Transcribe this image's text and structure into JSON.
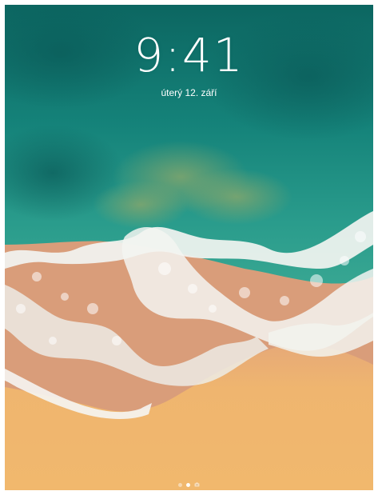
{
  "lock_screen": {
    "time": "9:41",
    "date": "úterý 12. září"
  },
  "page_indicator": {
    "pages": 3,
    "active_index": 1,
    "icons": [
      "page-dot",
      "page-dot",
      "camera-icon"
    ]
  },
  "wallpaper": {
    "subject": "ocean-waves-beach",
    "colors": {
      "deep_water": "#0f6f6a",
      "shallow_water": "#2aa394",
      "foam": "#f4f4f2",
      "wet_sand": "#d6a27a",
      "sand": "#eeb573"
    }
  }
}
